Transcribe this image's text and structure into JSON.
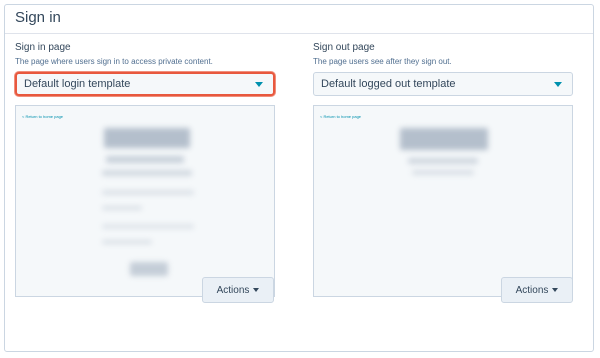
{
  "section": {
    "title": "Sign in"
  },
  "sign_in": {
    "label": "Sign in page",
    "description": "The page where users sign in to access private content.",
    "selected": "Default login template",
    "preview_link": "< Return to home page"
  },
  "sign_out": {
    "label": "Sign out page",
    "description": "The page users see after they sign out.",
    "selected": "Default logged out template",
    "preview_link": "< Return to home page"
  },
  "buttons": {
    "actions": "Actions"
  },
  "icons": {
    "select_caret": "caret-down-icon",
    "button_caret": "caret-down-icon"
  },
  "colors": {
    "highlight": "#e8583e",
    "accent": "#0091ae",
    "text": "#33475b"
  }
}
